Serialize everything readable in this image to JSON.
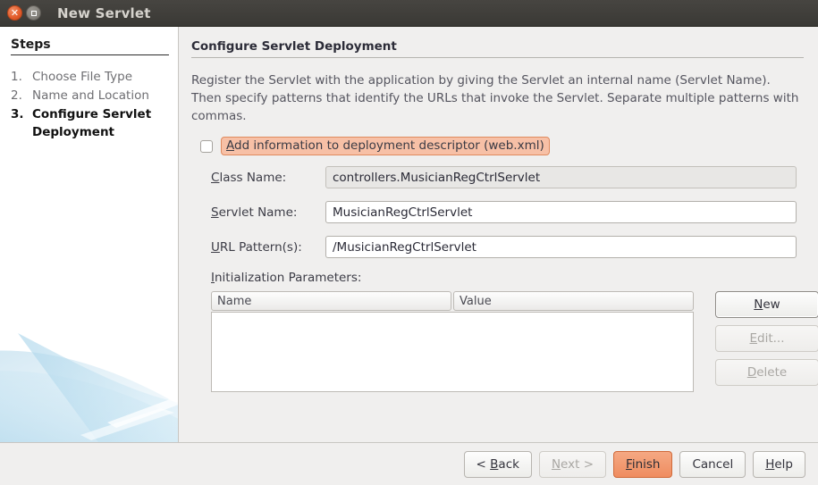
{
  "window": {
    "title": "New Servlet",
    "close_icon": "close-icon",
    "maximize_icon": "maximize-icon"
  },
  "steps": {
    "heading": "Steps",
    "items": [
      {
        "num": "1.",
        "label": "Choose File Type",
        "current": false
      },
      {
        "num": "2.",
        "label": "Name and Location",
        "current": false
      },
      {
        "num": "3.",
        "label": "Configure Servlet Deployment",
        "current": true
      }
    ]
  },
  "content": {
    "title": "Configure Servlet Deployment",
    "description": "Register the Servlet with the application by giving the Servlet an internal name (Servlet Name). Then specify patterns that identify the URLs that invoke the Servlet. Separate multiple patterns with commas.",
    "deployment_descriptor": {
      "label": "Add information to deployment descriptor (web.xml)",
      "mnemonic": "A",
      "rest": "dd information to deployment descriptor (web.xml)",
      "checked": false,
      "highlight_color": "#f7c0a6",
      "highlight_border": "#e08a5e"
    },
    "fields": [
      {
        "label": "Class Name:",
        "mnemonic": "C",
        "label_rest": "lass Name:",
        "value": "controllers.MusicianRegCtrlServlet",
        "readonly": true
      },
      {
        "label": "Servlet Name:",
        "mnemonic": "S",
        "label_rest": "ervlet Name:",
        "value": "MusicianRegCtrlServlet",
        "readonly": false
      },
      {
        "label": "URL Pattern(s):",
        "mnemonic": "U",
        "label_rest": "RL Pattern(s):",
        "value": "/MusicianRegCtrlServlet",
        "readonly": false
      }
    ],
    "init_params": {
      "label": "Initialization Parameters:",
      "mnemonic": "I",
      "label_rest": "nitialization Parameters:",
      "columns": [
        "Name",
        "Value"
      ],
      "rows": [],
      "buttons": [
        {
          "label": "New",
          "mnemonic": "N",
          "rest": "ew",
          "enabled": true,
          "default": true
        },
        {
          "label": "Edit...",
          "mnemonic": "E",
          "rest": "dit...",
          "enabled": false,
          "default": false
        },
        {
          "label": "Delete",
          "mnemonic": "D",
          "rest": "elete",
          "enabled": false,
          "default": false
        }
      ]
    }
  },
  "footer": {
    "buttons": [
      {
        "label": "< Back",
        "prefix": "< ",
        "mnemonic": "B",
        "rest": "ack",
        "enabled": true,
        "highlighted": false
      },
      {
        "label": "Next >",
        "prefix": "",
        "mnemonic": "N",
        "rest": "ext >",
        "enabled": false,
        "highlighted": false
      },
      {
        "label": "Finish",
        "prefix": "",
        "mnemonic": "F",
        "rest": "inish",
        "enabled": true,
        "highlighted": true
      },
      {
        "label": "Cancel",
        "prefix": "",
        "mnemonic": "",
        "rest": "Cancel",
        "enabled": true,
        "highlighted": false
      },
      {
        "label": "Help",
        "prefix": "",
        "mnemonic": "H",
        "rest": "elp",
        "enabled": true,
        "highlighted": false
      }
    ],
    "finish_color": "#ef8d60"
  }
}
